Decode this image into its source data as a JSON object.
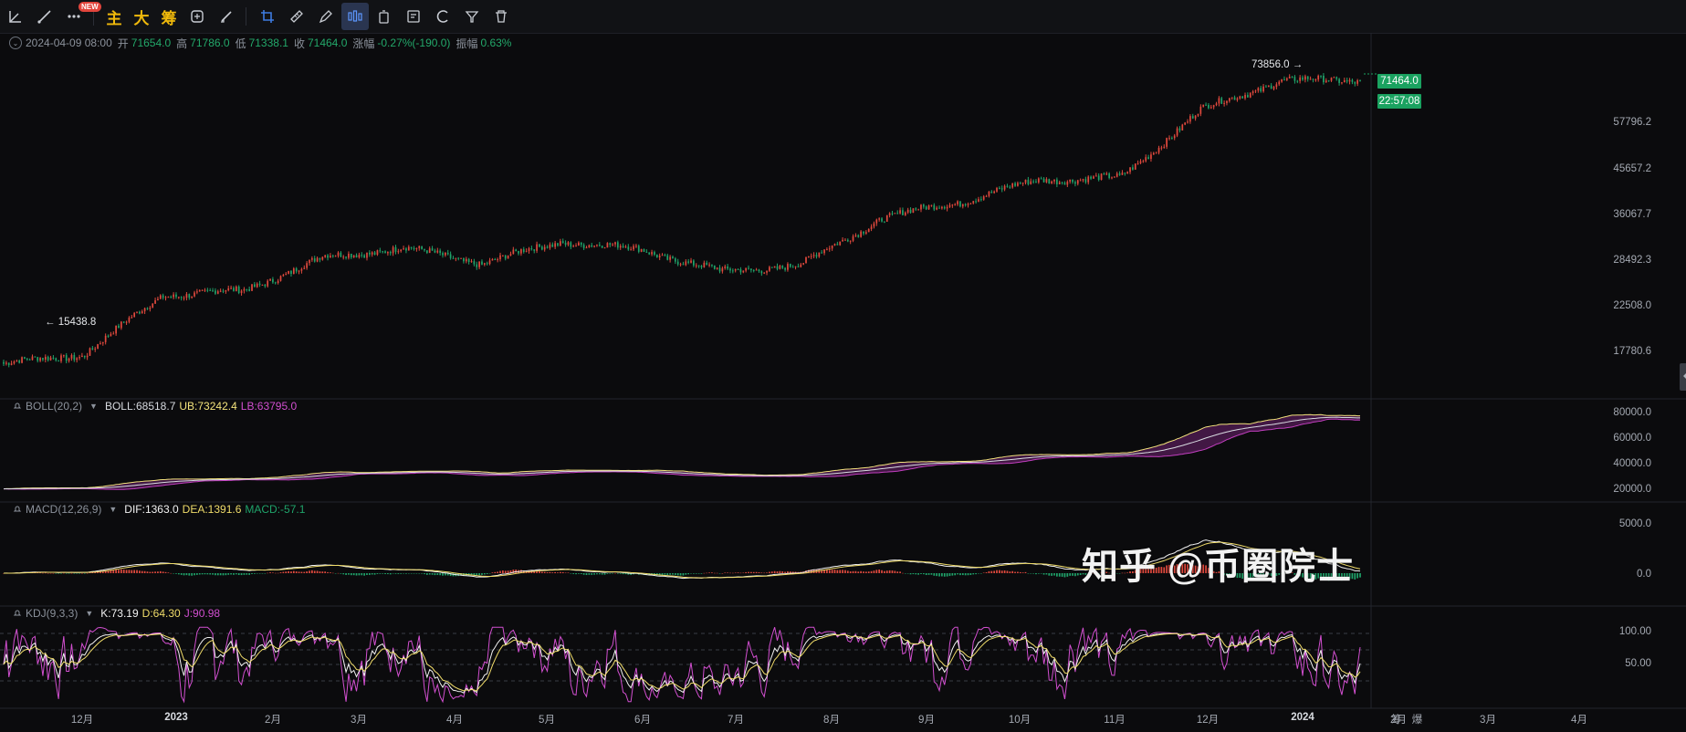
{
  "toolbar": {
    "new_badge": "NEW",
    "text_buttons": [
      "主",
      "大",
      "筹"
    ],
    "icons": [
      "trendline-icon",
      "line-icon",
      "more-dots-icon",
      "shape-icon",
      "brush-icon",
      "crop-icon",
      "ruler-icon",
      "pen-icon",
      "chart-mode-icon",
      "copy-icon",
      "edit-icon",
      "magnet-icon",
      "filter-icon",
      "trash-icon"
    ]
  },
  "candle_info": {
    "datetime": "2024-04-09 08:00",
    "open_label": "开",
    "open": "71654.0",
    "high_label": "高",
    "high": "71786.0",
    "low_label": "低",
    "low": "71338.1",
    "close_label": "收",
    "close": "71464.0",
    "change_label": "涨幅",
    "change": "-0.27%(-190.0)",
    "amplitude_label": "振幅",
    "amplitude": "0.63%"
  },
  "price_axis": [
    "57796.2",
    "45657.2",
    "36067.7",
    "28492.3",
    "22508.0",
    "17780.6"
  ],
  "last_price": "71464.0",
  "countdown": "22:57:08",
  "annotations": {
    "max": "73856.0",
    "min": "15438.8"
  },
  "boll": {
    "name": "BOLL(20,2)",
    "boll": "BOLL:68518.7",
    "ub": "UB:73242.4",
    "lb": "LB:63795.0",
    "axis": [
      "80000.0",
      "60000.0",
      "40000.0",
      "20000.0"
    ]
  },
  "macd": {
    "name": "MACD(12,26,9)",
    "dif": "DIF:1363.0",
    "dea": "DEA:1391.6",
    "macd": "MACD:-57.1",
    "axis": [
      "5000.0",
      "0.0"
    ]
  },
  "kdj": {
    "name": "KDJ(9,3,3)",
    "k": "K:73.19",
    "d": "D:64.30",
    "j": "J:90.98",
    "axis": [
      "100.00",
      "50.00"
    ]
  },
  "time_axis": [
    {
      "label": "12月",
      "year": false
    },
    {
      "label": "2023",
      "year": true
    },
    {
      "label": "2月",
      "year": false
    },
    {
      "label": "3月",
      "year": false
    },
    {
      "label": "4月",
      "year": false
    },
    {
      "label": "5月",
      "year": false
    },
    {
      "label": "6月",
      "year": false
    },
    {
      "label": "7月",
      "year": false
    },
    {
      "label": "8月",
      "year": false
    },
    {
      "label": "9月",
      "year": false
    },
    {
      "label": "10月",
      "year": false
    },
    {
      "label": "11月",
      "year": false
    },
    {
      "label": "12月",
      "year": false
    },
    {
      "label": "2024",
      "year": true
    },
    {
      "label": "2月",
      "year": false
    },
    {
      "label": "3月",
      "year": false
    },
    {
      "label": "4月",
      "year": false
    }
  ],
  "axis_buttons": [
    "筹",
    "爆"
  ],
  "watermark": "知乎 @币圈院士",
  "colors": {
    "up": "#e0493d",
    "down": "#1fa36a",
    "boll_ub": "#f3e37c",
    "boll_lb": "#c23fbf",
    "dif": "#f2f2f2",
    "dea": "#f0dc6a",
    "k": "#f2f2f2",
    "d": "#f0dc6a",
    "j": "#d24fd0"
  },
  "chart_data": {
    "type": "candlestick",
    "x_range": [
      "2022-11",
      "2024-04-09"
    ],
    "close_trend": [
      {
        "t": "2022-11",
        "v": 16000
      },
      {
        "t": "2022-12",
        "v": 16800
      },
      {
        "t": "2023-01",
        "v": 23000
      },
      {
        "t": "2023-02",
        "v": 23500
      },
      {
        "t": "2023-03",
        "v": 28000
      },
      {
        "t": "2023-04",
        "v": 29500
      },
      {
        "t": "2023-05",
        "v": 27200
      },
      {
        "t": "2023-06",
        "v": 30500
      },
      {
        "t": "2023-07",
        "v": 29200
      },
      {
        "t": "2023-08",
        "v": 26000
      },
      {
        "t": "2023-09",
        "v": 27000
      },
      {
        "t": "2023-10",
        "v": 34500
      },
      {
        "t": "2023-11",
        "v": 37700
      },
      {
        "t": "2023-12",
        "v": 42300
      },
      {
        "t": "2024-01",
        "v": 42600
      },
      {
        "t": "2024-02",
        "v": 61000
      },
      {
        "t": "2024-03",
        "v": 71300
      },
      {
        "t": "2024-04",
        "v": 71464
      }
    ],
    "max": 73856.0,
    "min": 15438.8
  }
}
